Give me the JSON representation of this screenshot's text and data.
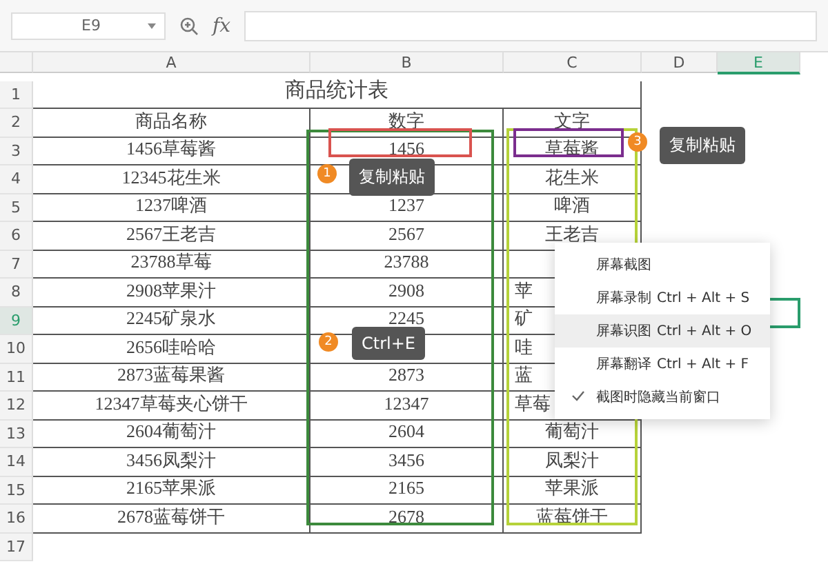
{
  "toolbar": {
    "name_box": "E9",
    "fx": "fx"
  },
  "columns": [
    {
      "label": "A",
      "selected": false
    },
    {
      "label": "B",
      "selected": false
    },
    {
      "label": "C",
      "selected": false
    },
    {
      "label": "D",
      "selected": false
    },
    {
      "label": "E",
      "selected": true
    }
  ],
  "title": {
    "num": "1",
    "text": "商品统计表"
  },
  "header": {
    "num": "2",
    "a": "商品名称",
    "b": "数字",
    "c": "文字"
  },
  "rows": [
    {
      "num": "3",
      "a": "1456草莓酱",
      "b": "1456",
      "c": "草莓酱",
      "selected": false,
      "clipped": false
    },
    {
      "num": "4",
      "a": "12345花生米",
      "c": "花生米",
      "selected": false,
      "clipped": false
    },
    {
      "num": "5",
      "a": "1237啤酒",
      "b": "1237",
      "c": "啤酒",
      "selected": false,
      "clipped": false
    },
    {
      "num": "6",
      "a": "2567王老吉",
      "b": "2567",
      "c": "王老吉",
      "selected": false,
      "clipped": false
    },
    {
      "num": "7",
      "a": "23788草莓",
      "b": "23788",
      "selected": false
    },
    {
      "num": "8",
      "a": "2908苹果汁",
      "b": "2908",
      "c": "苹",
      "selected": false,
      "clipped": true
    },
    {
      "num": "9",
      "a": "2245矿泉水",
      "b": "2245",
      "c": "矿",
      "selected": true,
      "clipped": true
    },
    {
      "num": "10",
      "a": "2656哇哈哈",
      "c": "哇",
      "selected": false,
      "clipped": true
    },
    {
      "num": "11",
      "a": "2873蓝莓果酱",
      "b": "2873",
      "c": "蓝",
      "selected": false,
      "clipped": true
    },
    {
      "num": "12",
      "a": "12347草莓夹心饼干",
      "b": "12347",
      "c": "草莓",
      "selected": false,
      "clipped": true
    },
    {
      "num": "13",
      "a": "2604葡萄汁",
      "b": "2604",
      "c": "葡萄汁",
      "selected": false,
      "clipped": false
    },
    {
      "num": "14",
      "a": "3456凤梨汁",
      "b": "3456",
      "c": "凤梨汁",
      "selected": false,
      "clipped": false
    },
    {
      "num": "15",
      "a": "2165苹果派",
      "b": "2165",
      "c": "苹果派",
      "selected": false,
      "clipped": false
    },
    {
      "num": "16",
      "a": "2678蓝莓饼干",
      "b": "2678",
      "c": "蓝莓饼干",
      "selected": false,
      "clipped": false
    }
  ],
  "empty_rows": [
    {
      "num": "17"
    }
  ],
  "steps": [
    {
      "badge": "1",
      "tip": "复制粘贴"
    },
    {
      "badge": "2",
      "tip": "Ctrl+E"
    },
    {
      "badge": "3",
      "tip": "复制粘贴"
    }
  ],
  "menu": [
    {
      "label": "屏幕截图",
      "hovered": false,
      "checked": false
    },
    {
      "label": "屏幕录制",
      "shortcut": "Ctrl + Alt + S",
      "hovered": false,
      "checked": false
    },
    {
      "label": "屏幕识图",
      "shortcut": "Ctrl + Alt + O",
      "hovered": true,
      "checked": false
    },
    {
      "label": "屏幕翻译",
      "shortcut": "Ctrl + Alt + F",
      "hovered": false,
      "checked": false
    },
    {
      "label": "截图时隐藏当前窗口",
      "hovered": false,
      "checked": true
    }
  ]
}
